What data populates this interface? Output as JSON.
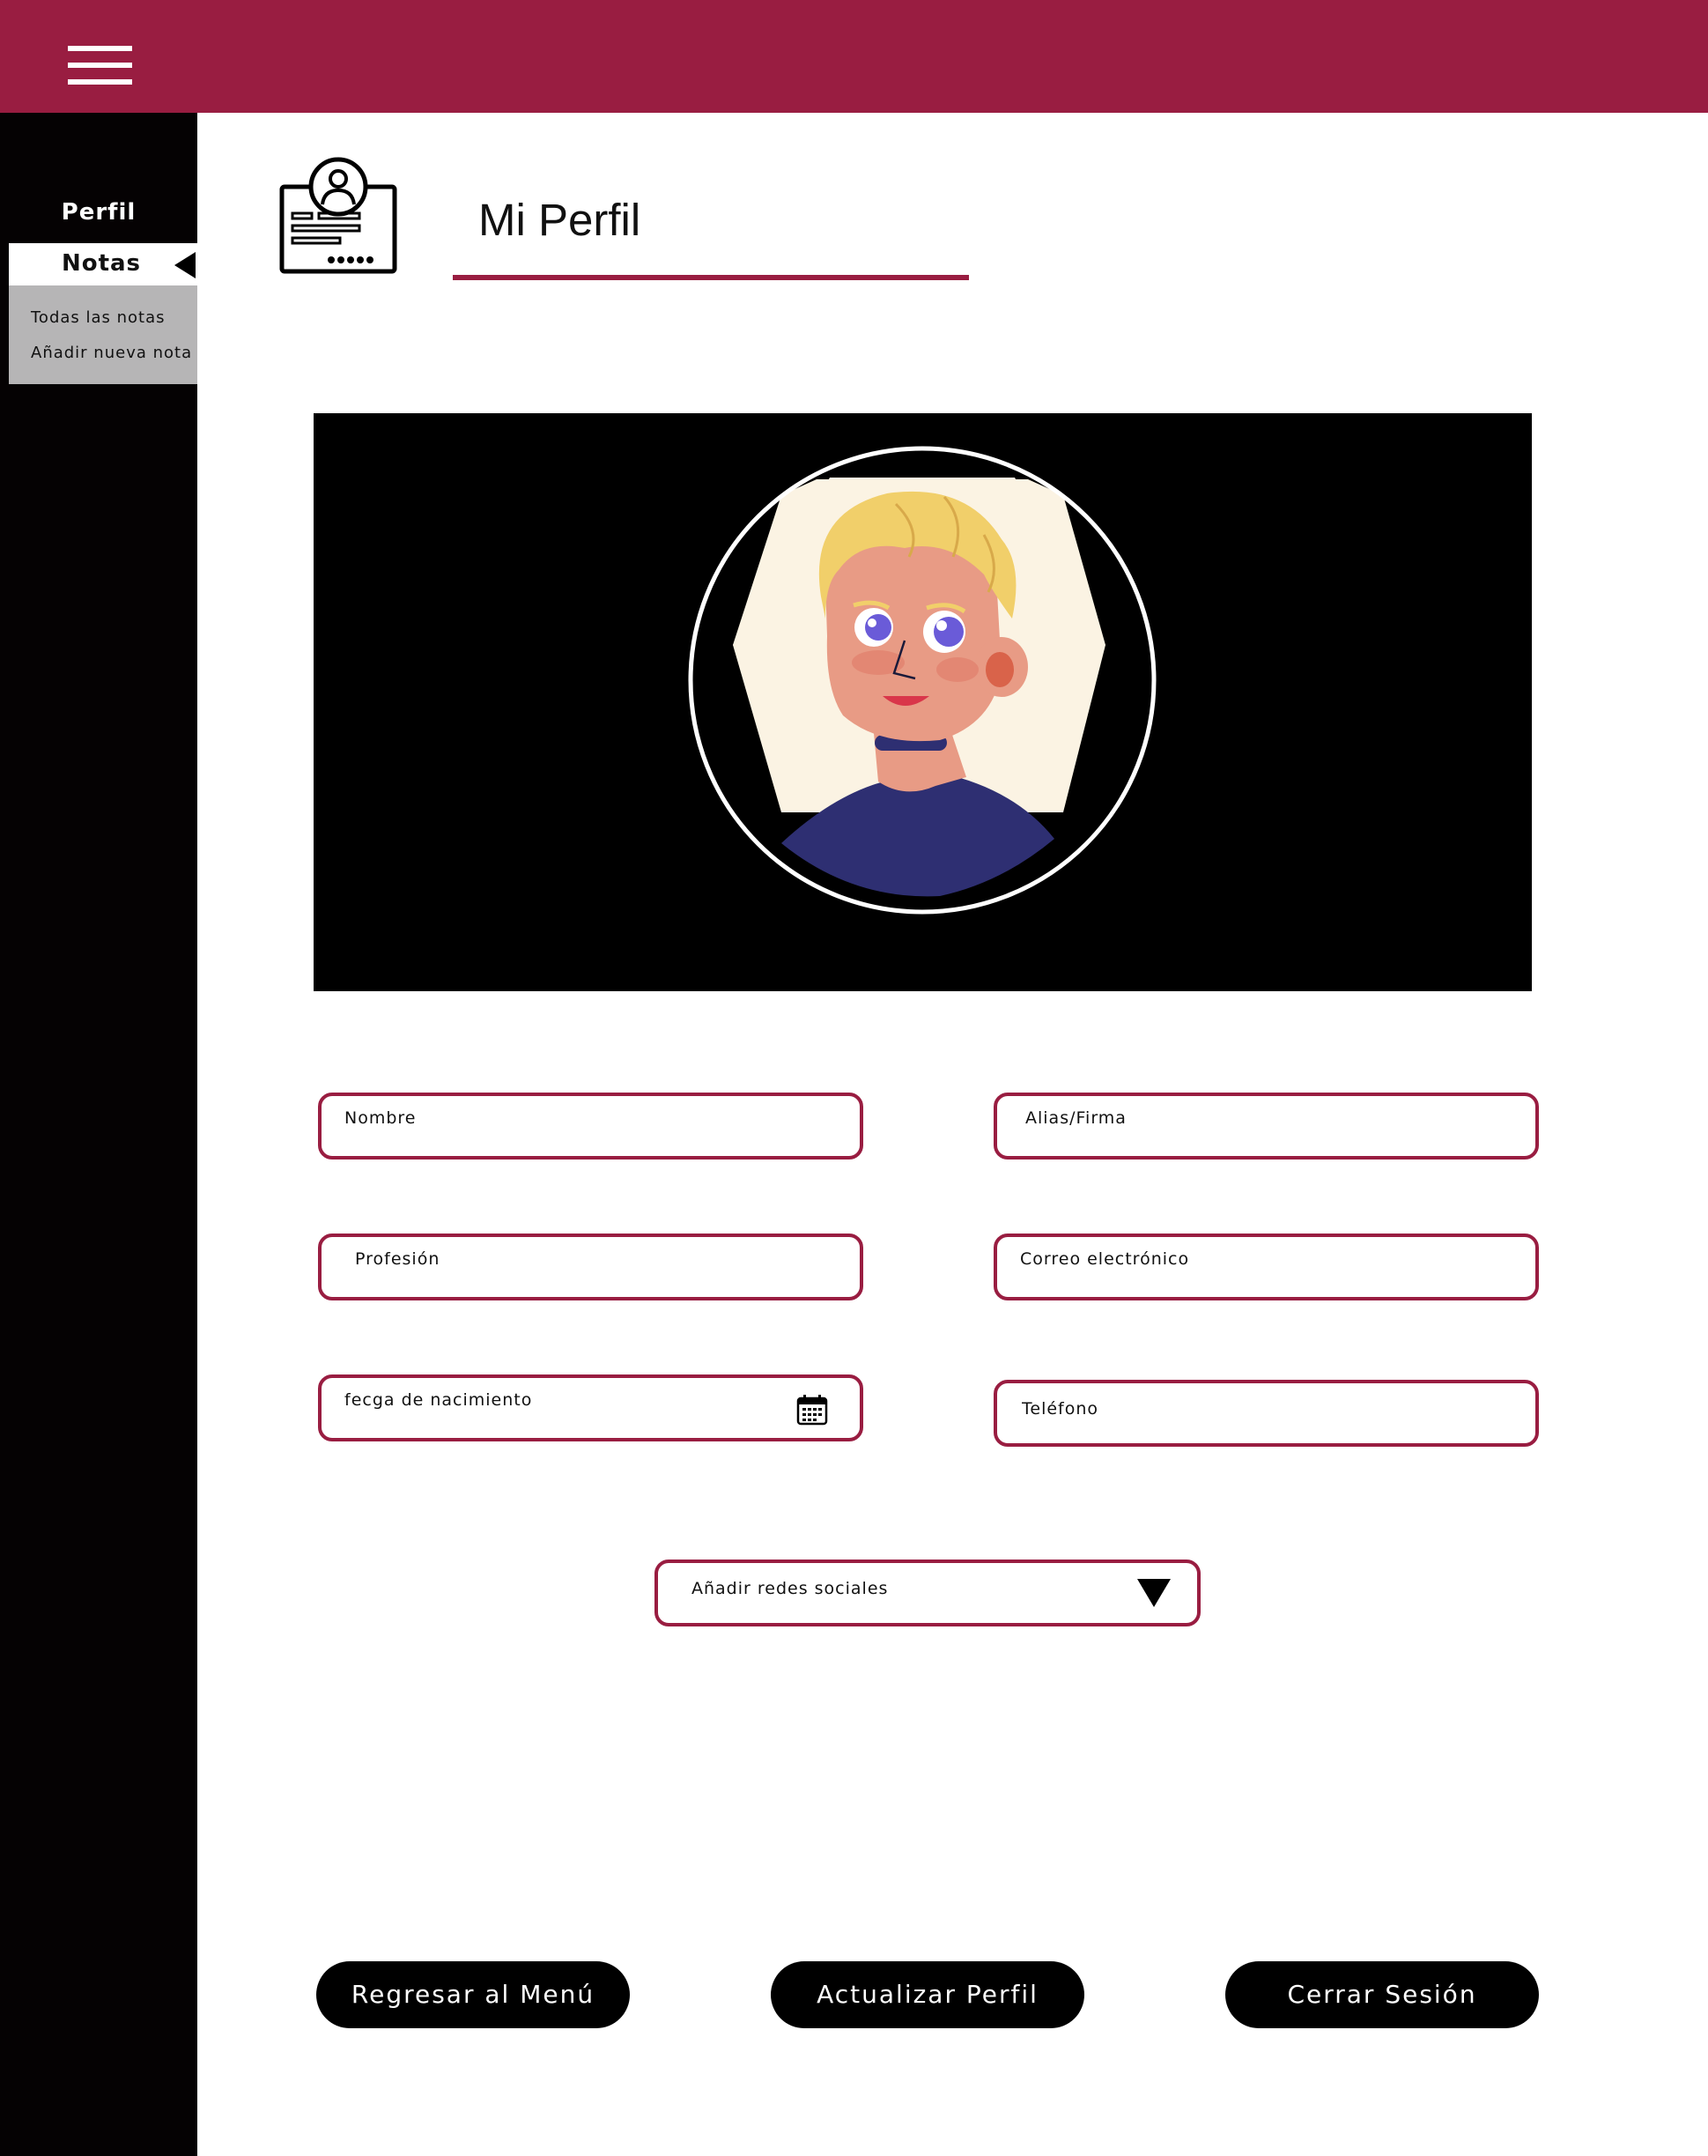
{
  "header": {
    "menu_icon": "hamburger-menu-icon",
    "background_color": "#991d41"
  },
  "sidebar": {
    "items": [
      {
        "label": "Perfil"
      },
      {
        "label": "Notas",
        "active": true
      }
    ],
    "submenu": [
      {
        "label": "Todas las notas"
      },
      {
        "label": "Añadir nueva nota"
      }
    ]
  },
  "main": {
    "title": "Mi Perfil",
    "title_icon": "profile-card-icon",
    "accent_color": "#991d41",
    "avatar_icon": "user-avatar-illustration"
  },
  "form": {
    "nombre": {
      "placeholder": "Nombre",
      "value": ""
    },
    "alias": {
      "placeholder": "Alias/Firma",
      "value": ""
    },
    "profesion": {
      "placeholder": "Profesión",
      "value": ""
    },
    "correo": {
      "placeholder": "Correo electrónico",
      "value": ""
    },
    "fecha": {
      "placeholder": "fecga de nacimiento",
      "value": "",
      "icon": "calendar-icon"
    },
    "telefono": {
      "placeholder": "Teléfono",
      "value": ""
    },
    "redes": {
      "label": "Añadir redes sociales",
      "icon": "dropdown-caret-icon"
    }
  },
  "buttons": {
    "back": "Regresar al Menú",
    "update": "Actualizar Perfil",
    "logout": "Cerrar Sesión"
  }
}
